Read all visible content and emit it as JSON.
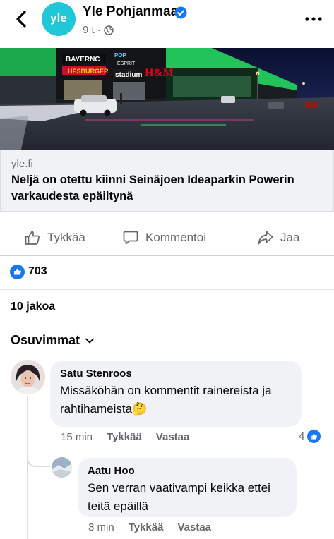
{
  "header": {
    "page_name": "Yle Pohjanmaa",
    "avatar_text": "yle",
    "time": "9 t",
    "separator": "·",
    "audience_icon": "globe-icon"
  },
  "link": {
    "domain": "yle.fi",
    "title": "Neljä on otettu kiinni Seinäjoen Ideaparkin Powerin varkaudesta epäiltynä"
  },
  "photo_signs": {
    "sign1": "BAYERNC",
    "sign2": "HESBURGER",
    "sign3": "POP",
    "sign4": "ESPRIT",
    "sign5": "stadium",
    "sign6": "H&M"
  },
  "actions": {
    "like": "Tykkää",
    "comment": "Kommentoi",
    "share": "Jaa"
  },
  "reactions": {
    "count": "703"
  },
  "shares": {
    "label": "10 jakoa"
  },
  "sort": {
    "label": "Osuvimmat"
  },
  "comments": [
    {
      "author": "Satu Stenroos",
      "text": "Missäköhän on kommentit rainereista ja rahtihameista🤔",
      "time": "15 min",
      "like": "Tykkää",
      "reply": "Vastaa",
      "likes": "4"
    },
    {
      "author": "Aatu Hoo",
      "text": "Sen verran vaativampi keikka ettei teitä epäillä",
      "time": "3 min",
      "like": "Tykkää",
      "reply": "Vastaa"
    }
  ],
  "colors": {
    "accent": "#1877f2",
    "muted": "#65676b",
    "bubble": "#f0f2f5",
    "yle": "#1fc7d8"
  }
}
